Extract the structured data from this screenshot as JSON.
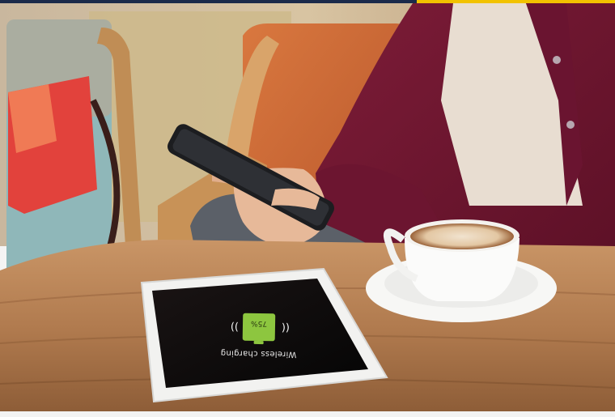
{
  "tablet": {
    "battery_label": "75%",
    "status_text": "Wireless charging"
  },
  "colors": {
    "top_bar_left": "#1b2a4a",
    "top_bar_right": "#f2c200",
    "battery_green": "#8dc63f",
    "sweater": "#6e1630",
    "table_wood": "#b07a4e"
  }
}
